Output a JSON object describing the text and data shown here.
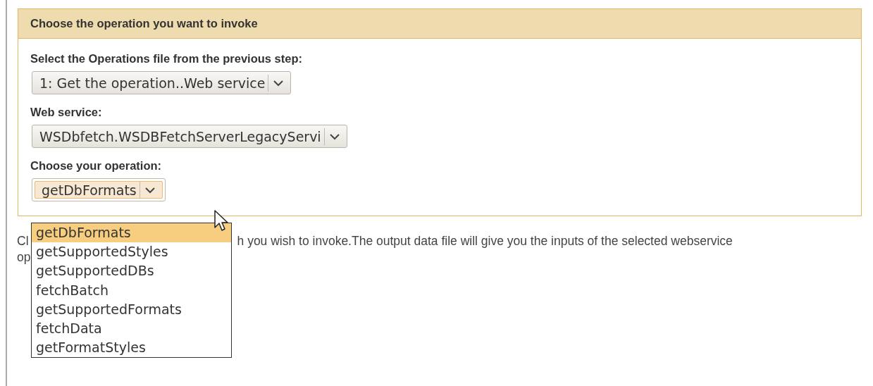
{
  "panel": {
    "title": "Choose the operation you want to invoke",
    "fields": [
      {
        "label": "Select the Operations file from the previous step:",
        "value": "1: Get the operation..Web service",
        "focused": false
      },
      {
        "label": "Web service:",
        "value": "WSDbfetch.WSDBFetchServerLegacyServi",
        "focused": false
      },
      {
        "label": "Choose your operation:",
        "value": "getDbFormats",
        "focused": true
      }
    ]
  },
  "dropdown": {
    "options": [
      {
        "label": "getDbFormats",
        "selected": true
      },
      {
        "label": "getSupportedStyles",
        "selected": false
      },
      {
        "label": "getSupportedDBs",
        "selected": false
      },
      {
        "label": "fetchBatch",
        "selected": false
      },
      {
        "label": "getSupportedFormats",
        "selected": false
      },
      {
        "label": "fetchData",
        "selected": false
      },
      {
        "label": "getFormatStyles",
        "selected": false
      }
    ]
  },
  "help_text": {
    "line_1_start": "Cl",
    "line_1_end": "h you wish to invoke.The output data file will give you the inputs of the selected webservice",
    "line_2_start": "op"
  }
}
